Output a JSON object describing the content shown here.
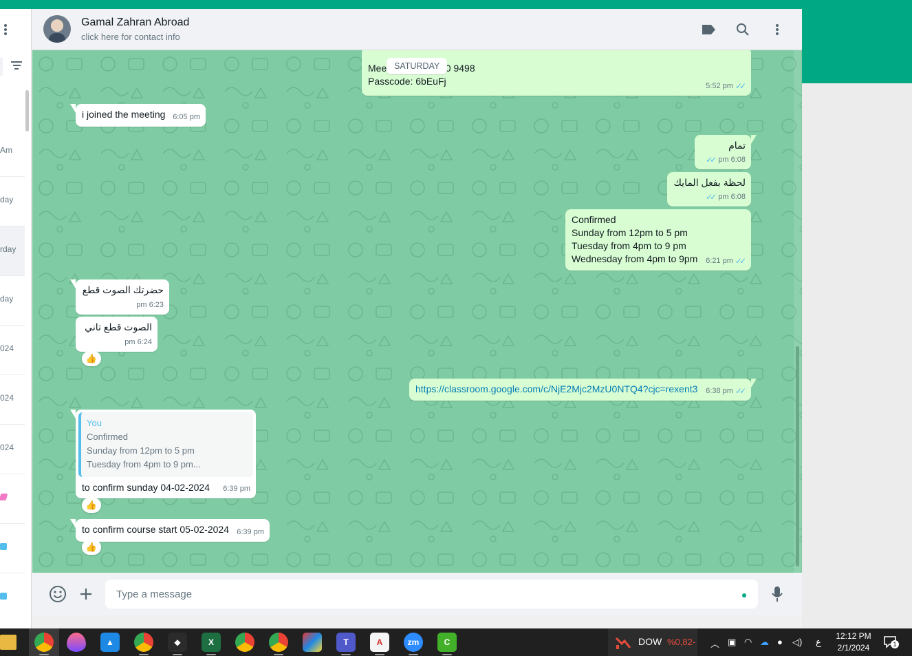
{
  "sidebar": {
    "items": [
      {
        "label": "Am"
      },
      {
        "label": "day"
      },
      {
        "label": "rday"
      },
      {
        "label": "day"
      },
      {
        "label": "024"
      },
      {
        "label": "024"
      },
      {
        "label": "024"
      }
    ]
  },
  "header": {
    "contact_name": "Gamal Zahran Abroad",
    "contact_subtitle": "click here for contact info"
  },
  "chat": {
    "date_pill": "SATURDAY",
    "messages": [
      {
        "dir": "out",
        "line1": "Mee",
        "line1_tail": "300 9498",
        "line2": "Passcode: 6bEuFj",
        "time": "5:52 pm"
      },
      {
        "dir": "in",
        "text": "i joined the meeting",
        "time": "6:05 pm"
      },
      {
        "dir": "out",
        "text": "تمام",
        "time": "6:08 pm"
      },
      {
        "dir": "out",
        "text": "لحظة بفعل المايك",
        "time": "6:08 pm"
      },
      {
        "dir": "out",
        "lines": [
          "Confirmed",
          "Sunday from 12pm to 5 pm",
          "Tuesday from 4pm to 9 pm",
          "Wednesday from 4pm to 9pm"
        ],
        "time": "6:21 pm"
      },
      {
        "dir": "in",
        "text": "حضرتك الصوت قطع",
        "time": "6:23 pm"
      },
      {
        "dir": "in",
        "text": "الصوت قطع تاني",
        "time": "6:24 pm",
        "reaction": "👍"
      },
      {
        "dir": "out",
        "text": "https://classroom.google.com/c/NjE2Mjc2MzU0NTQ4?cjc=rexent3",
        "time": "6:38 pm"
      },
      {
        "dir": "in",
        "quote": {
          "name": "You",
          "lines": [
            "Confirmed",
            "Sunday from 12pm to 5 pm",
            "Tuesday from 4pm to 9 pm..."
          ]
        },
        "text": "to confirm sunday 04-02-2024",
        "time": "6:39 pm",
        "reaction": "👍"
      },
      {
        "dir": "in",
        "text": "to confirm course start 05-02-2024",
        "time": "6:39 pm",
        "reaction": "👍"
      }
    ]
  },
  "footer": {
    "placeholder": "Type a message"
  },
  "taskbar": {
    "stock_name": "DOW",
    "stock_change": "%0,82-",
    "lang": "ع",
    "time": "12:12 PM",
    "date": "2/1/2024",
    "notification_count": "1"
  },
  "colors": {
    "accent": "#00a884",
    "chat_bg": "#7fcba3",
    "outgoing_bubble": "#d9fdd3",
    "read_ticks": "#53bdeb",
    "stock_down": "#e74c3c"
  },
  "icons": [
    "menu-dots-icon",
    "filter-icon",
    "label-icon",
    "search-icon",
    "kebab-menu-icon",
    "emoji-icon",
    "plus-icon",
    "mic-icon",
    "thumbs-up-icon",
    "double-check-icon"
  ]
}
